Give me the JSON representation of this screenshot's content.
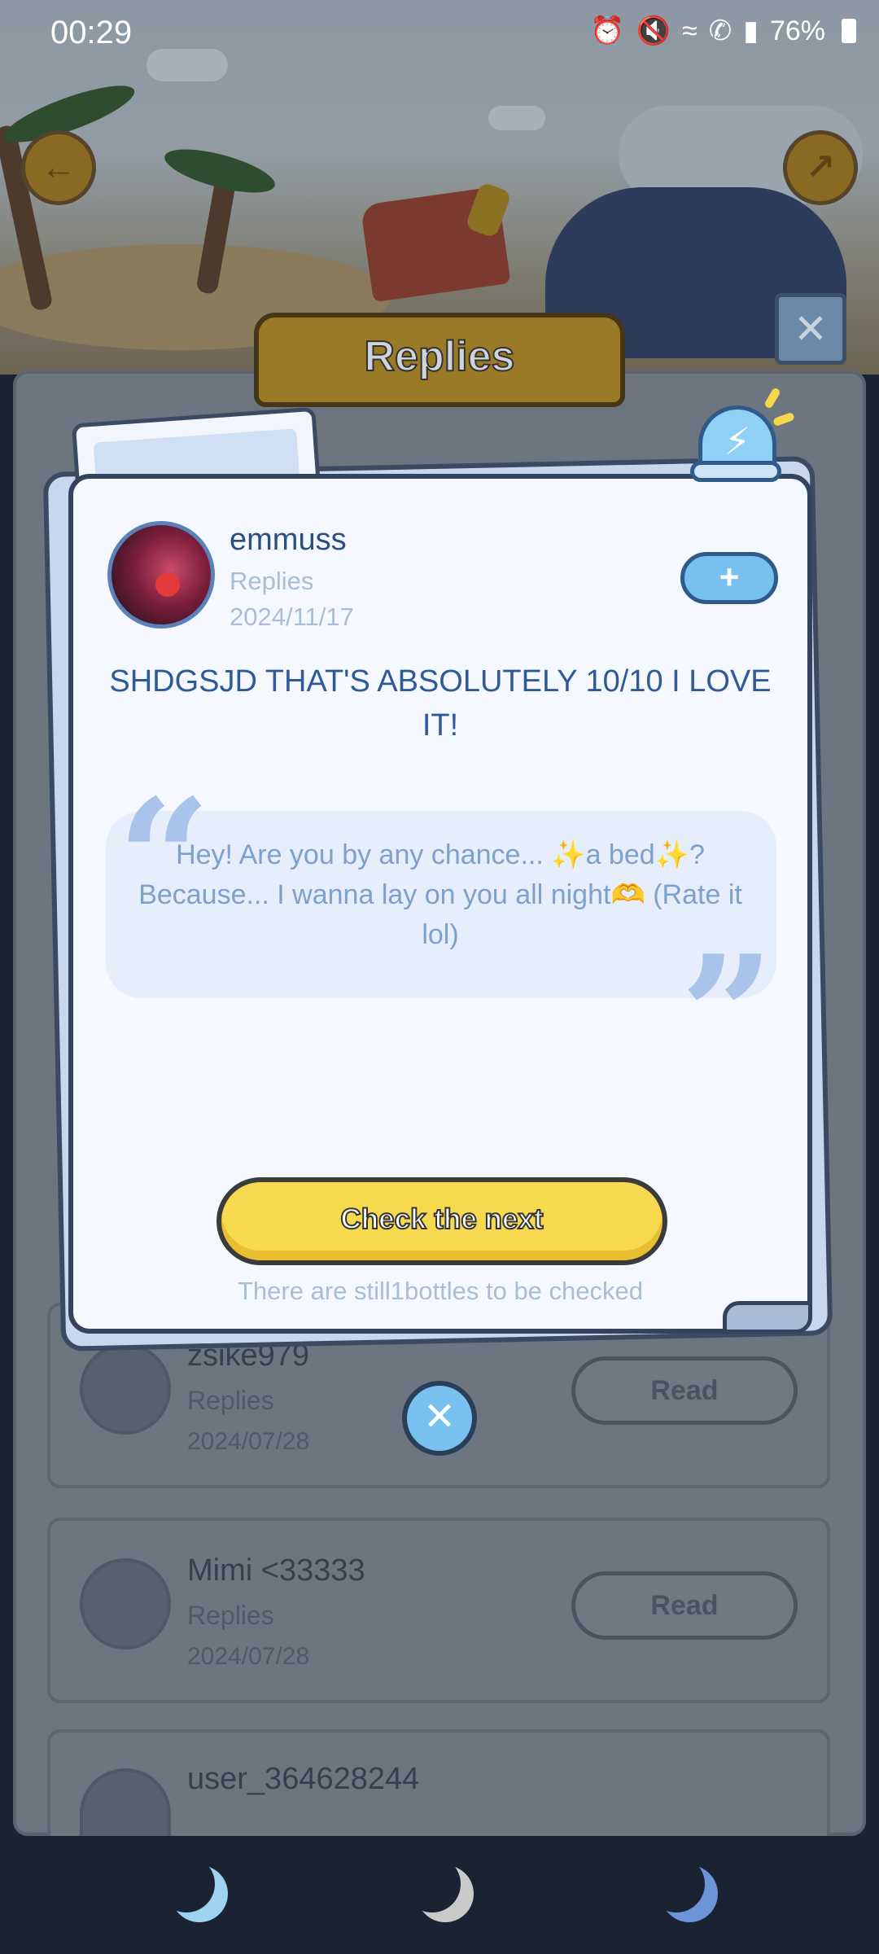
{
  "status_bar": {
    "time": "00:29",
    "battery": "76%",
    "icons": [
      "alarm-icon",
      "mute-icon",
      "wifi-icon",
      "wifi-call-icon",
      "signal-icon",
      "battery-icon"
    ]
  },
  "header": {
    "title": "Replies"
  },
  "modal": {
    "username": "emmuss",
    "subtitle": "Replies",
    "date": "2024/11/17",
    "follow_label": "+",
    "reply_text": "SHDGSJD THAT'S ABSOLUTELY 10/10 I LOVE IT!",
    "quoted_text": "Hey! Are you by any chance... ✨a bed✨? Because... I wanna lay on you all night🫶 (Rate it lol)",
    "next_button_label": "Check the next",
    "remaining_text": "There are still1bottles to be checked"
  },
  "list": {
    "items": [
      {
        "name": "zsike979",
        "subtitle": "Replies",
        "date": "2024/07/28",
        "button": "Read"
      },
      {
        "name": "Mimi <33333",
        "subtitle": "Replies",
        "date": "2024/07/28",
        "button": "Read"
      },
      {
        "name": "user_364628244",
        "subtitle": "",
        "date": "",
        "button": ""
      }
    ]
  },
  "colors": {
    "accent_yellow": "#f7d94f",
    "accent_blue": "#78c0ef",
    "text_blue": "#2e5a9a",
    "nav_bg": "#1b2333"
  }
}
